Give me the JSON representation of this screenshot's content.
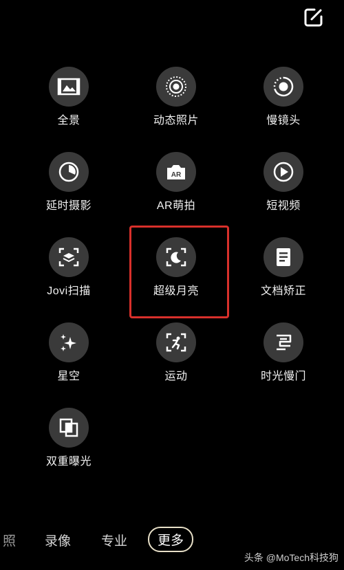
{
  "modes": [
    {
      "label": "全景",
      "icon": "panorama-icon"
    },
    {
      "label": "动态照片",
      "icon": "live-photo-icon"
    },
    {
      "label": "慢镜头",
      "icon": "slow-motion-icon"
    },
    {
      "label": "延时摄影",
      "icon": "time-lapse-icon"
    },
    {
      "label": "AR萌拍",
      "icon": "ar-icon"
    },
    {
      "label": "短视频",
      "icon": "short-video-icon"
    },
    {
      "label": "Jovi扫描",
      "icon": "jovi-scan-icon"
    },
    {
      "label": "超级月亮",
      "icon": "super-moon-icon"
    },
    {
      "label": "文档矫正",
      "icon": "document-icon"
    },
    {
      "label": "星空",
      "icon": "starry-sky-icon"
    },
    {
      "label": "运动",
      "icon": "sport-icon"
    },
    {
      "label": "时光慢门",
      "icon": "slow-shutter-icon"
    },
    {
      "label": "双重曝光",
      "icon": "double-exposure-icon"
    }
  ],
  "tabs": {
    "photo_partial": "照",
    "video": "录像",
    "pro": "专业",
    "more": "更多"
  },
  "watermark": "头条 @MoTech科技狗",
  "colors": {
    "highlight": "#d9302b",
    "circle_bg": "#3a3a3a"
  }
}
